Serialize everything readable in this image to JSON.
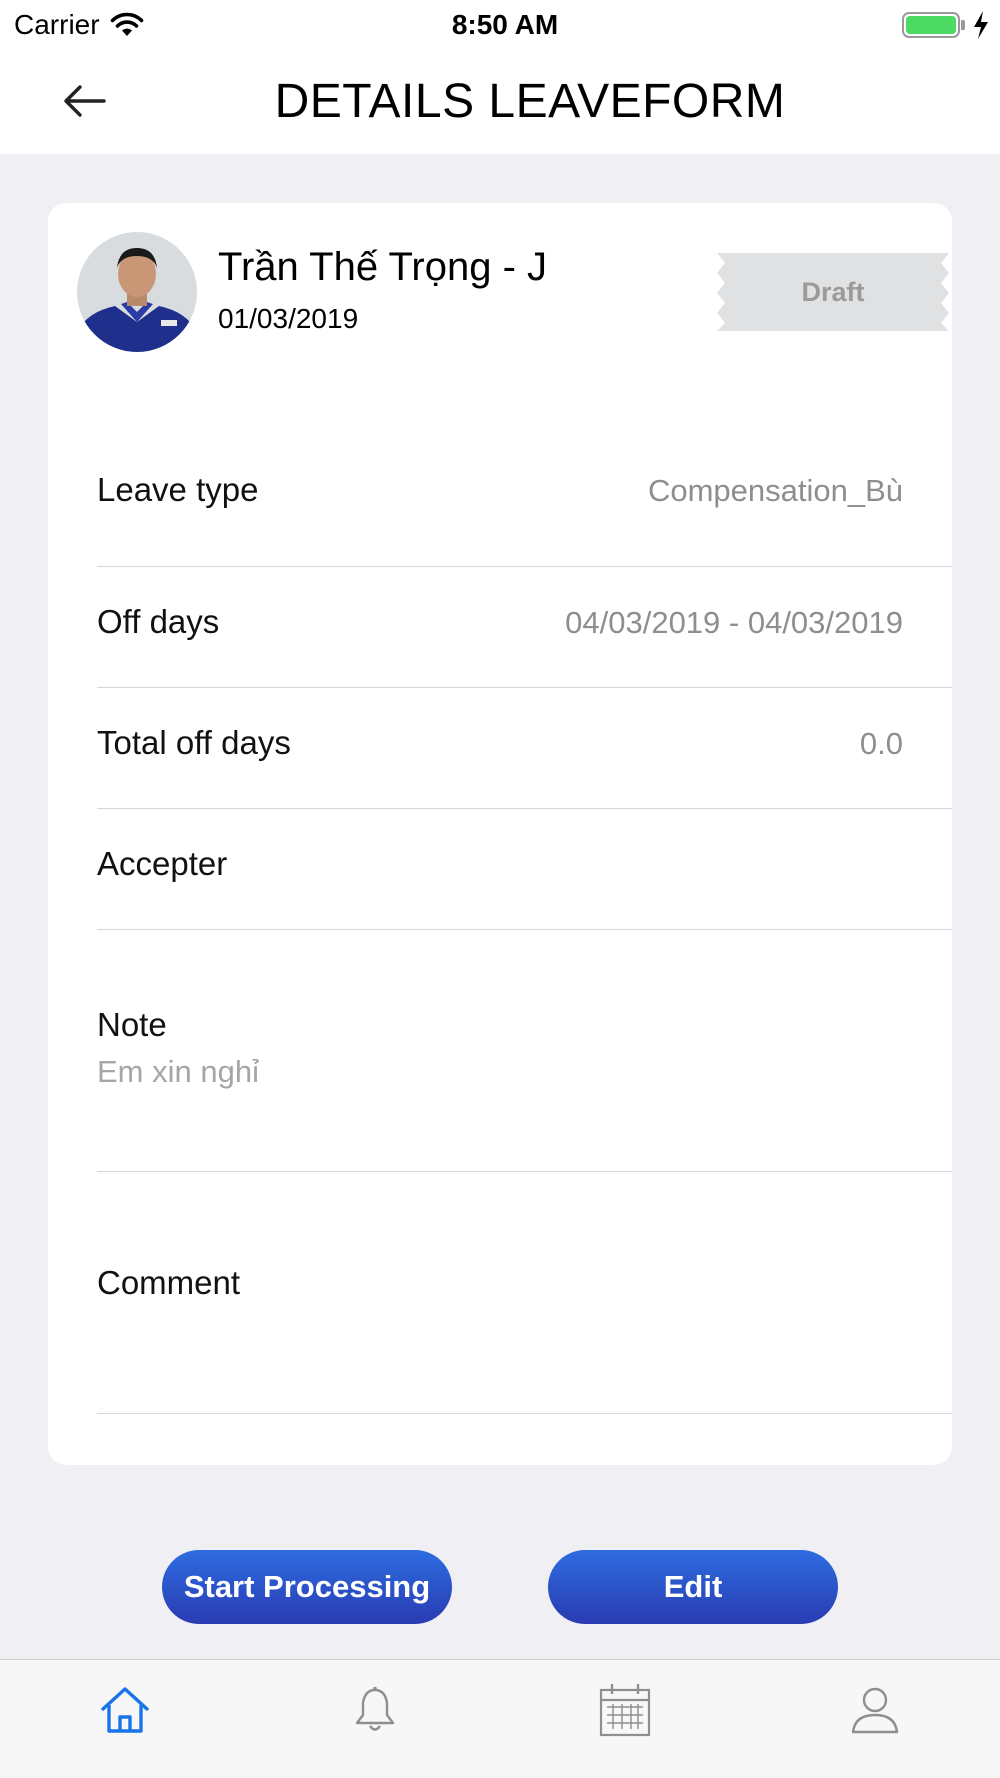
{
  "status_bar": {
    "carrier": "Carrier",
    "time": "8:50 AM"
  },
  "header": {
    "title": "DETAILS LEAVEFORM",
    "back_icon": "arrow-left-icon"
  },
  "employee": {
    "name": "Trần Thế Trọng - J",
    "date": "01/03/2019",
    "status": "Draft"
  },
  "fields": {
    "leave_type": {
      "label": "Leave type",
      "value": "Compensation_Bù"
    },
    "off_days": {
      "label": "Off days",
      "value": "04/03/2019 - 04/03/2019"
    },
    "total_off_days": {
      "label": "Total off days",
      "value": "0.0"
    },
    "accepter": {
      "label": "Accepter",
      "value": ""
    },
    "note": {
      "label": "Note",
      "value": "Em xin nghỉ"
    },
    "comment": {
      "label": "Comment",
      "value": ""
    }
  },
  "actions": {
    "start_processing": "Start Processing",
    "edit": "Edit"
  },
  "tab_bar": {
    "items": [
      {
        "icon": "home-icon",
        "active": true
      },
      {
        "icon": "bell-icon",
        "active": false
      },
      {
        "icon": "calendar-icon",
        "active": false
      },
      {
        "icon": "user-icon",
        "active": false
      }
    ]
  },
  "colors": {
    "accent": "#2d6ce0",
    "button_gradient_end": "#2a3bb2",
    "background": "#efeff4",
    "badge_bg": "#e0e1e3",
    "inactive_icon": "#8e8e93"
  }
}
